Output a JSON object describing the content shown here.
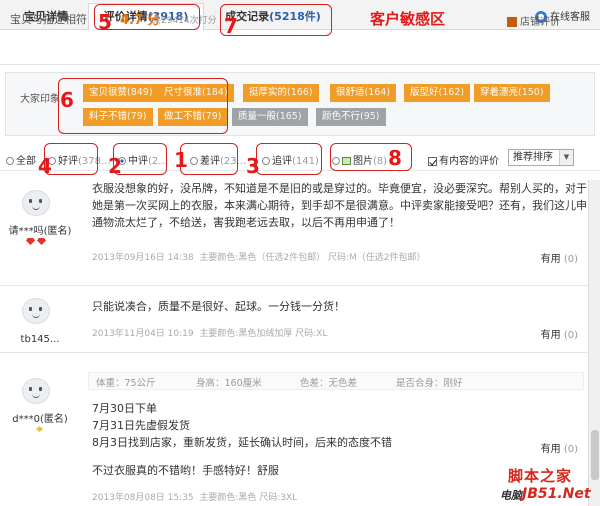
{
  "tabs": [
    {
      "label": "宝贝详情",
      "count": ""
    },
    {
      "label": "评价详情",
      "count": "(3918)"
    },
    {
      "label": "成交记录",
      "count": "(5218件)"
    }
  ],
  "service": {
    "label": "在线客服"
  },
  "score": {
    "label": "宝贝与描述相符",
    "value": "4.7 分",
    "sub": "共29414次打分",
    "shop_eval": "店铺评价"
  },
  "sensitive_label": "客户敏感区",
  "impressions": {
    "label": "大家印象",
    "tags": [
      {
        "text": "宝贝很赞",
        "count": "(849)"
      },
      {
        "text": "尺寸很准",
        "count": "(184)"
      },
      {
        "text": "挺厚实的",
        "count": "(166)"
      },
      {
        "text": "很舒适",
        "count": "(164)"
      },
      {
        "text": "版型好",
        "count": "(162)"
      },
      {
        "text": "穿着漂亮",
        "count": "(150)"
      },
      {
        "text": "料子不错",
        "count": "(79)"
      },
      {
        "text": "做工不错",
        "count": "(79)"
      },
      {
        "text": "质量一般",
        "count": "(165)"
      },
      {
        "text": "颜色不行",
        "count": "(95)"
      }
    ]
  },
  "filters": {
    "options": [
      {
        "label": "全部",
        "count": ""
      },
      {
        "label": "好评",
        "count": "(378..."
      },
      {
        "label": "中评",
        "count": "(2..."
      },
      {
        "label": "差评",
        "count": "(23..."
      },
      {
        "label": "追评",
        "count": "(141)"
      },
      {
        "label": "图片",
        "count": "(8)"
      }
    ],
    "has_content": "有内容的评价",
    "sort_label": "推荐排序"
  },
  "annotations": [
    "5",
    "7",
    "6",
    "4",
    "2",
    "1",
    "3",
    "8"
  ],
  "reviews": [
    {
      "user": "请***吗(匿名)",
      "text": "衣服没想象的好，没吊牌，不知道是不是旧的或是穿过的。毕竟便宜，没必要深究。帮别人买的，对于她是第一次买网上的衣服，本来满心期待，到手却不是很满意。中评卖家能接受吧？还有，我们这儿申通物流太烂了，不给送，害我跑老远去取，以后不再用申通了！",
      "date": "2013年09月16日 14:38",
      "specs": "主要颜色:黑色（任选2件包邮）  尺码:M（任选2件包邮）",
      "useful": "有用",
      "useful_count": "(0)"
    },
    {
      "user": "tb145...",
      "text": "只能说凑合，质量不是很好、起球。一分钱一分货！",
      "date": "2013年11月04日 10:19",
      "specs": "主要颜色:黑色加绒加厚  尺码:XL",
      "useful": "有用",
      "useful_count": "(0)"
    },
    {
      "user": "d***0(匿名)",
      "attrs": {
        "weight": "体重：75公斤",
        "height": "身高：160厘米",
        "color": "色差：无色差",
        "fit": "是否合身：刚好"
      },
      "lines": [
        "7月30日下单",
        "7月31日先虚假发货",
        "8月3日找到店家，重新发货，延长确认时间，后来的态度不错",
        "",
        "不过衣服真的不错哟！手感特好！舒服"
      ],
      "date": "2013年08月08日 15:35",
      "specs": "主要颜色:黑色  尺码:3XL",
      "useful": "有用",
      "useful_count": "(0)"
    }
  ],
  "watermark": {
    "line1": "脚本之家",
    "line2": "电脑",
    "line3": "JB51.Net"
  }
}
